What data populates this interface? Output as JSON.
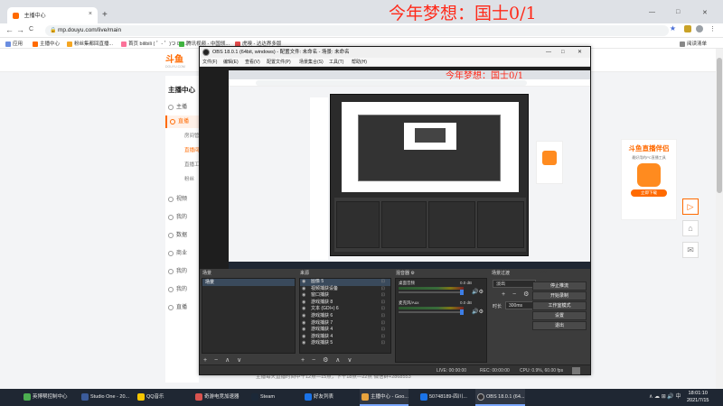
{
  "browser": {
    "tab_title": "主播中心",
    "url": "mp.douyu.com/live/main",
    "win_min": "—",
    "win_max": "□",
    "win_close": "✕",
    "new_tab": "+",
    "tab_close": "×",
    "nav_back": "←",
    "nav_forward": "→",
    "nav_reload": "C",
    "nav_home": "⌂",
    "bookmarks": [
      "应用",
      "主播中心",
      "粉丝集都回直播...",
      "首页 bilibili ( ゜- ゜)つ Da...",
      "腾讯视频 - 中国领...",
      "虎嗅 - 达达界多版"
    ],
    "reading_list": "阅读清单"
  },
  "overlay_headline": "今年梦想：国士0/1",
  "douyu": {
    "logo": "斗鱼",
    "logo_sub": "DOUYU.COM",
    "sidebar_title": "主播中心",
    "sidebar_items": [
      "主播",
      "直播",
      "视频",
      "我的",
      "数据",
      "商业",
      "我的",
      "我的",
      "直播"
    ],
    "sidebar_subs": [
      "房间管",
      "直播间",
      "直播工",
      "粉丝"
    ],
    "footer_line1": "主播每天直播时间中午12点—15点，下午18点—22点 微信群+2868553",
    "promo_title": "斗鱼直播伴侣",
    "promo_sub": "最好用的PC直播工具",
    "promo_btn": "立即下载"
  },
  "obs": {
    "title": "OBS 18.0.1 (64bit, windows) - 配置文件: 未命名 - 场景: 未命名",
    "menu": [
      "文件(F)",
      "编辑(E)",
      "查看(V)",
      "配置文件(P)",
      "场景集合(S)",
      "工具(T)",
      "帮助(H)"
    ],
    "docks": {
      "scenes": "场景",
      "sources": "来源",
      "mixer": "混音器",
      "transitions": "场景过渡",
      "controls": "控件"
    },
    "scenes": [
      "场景"
    ],
    "sources": [
      "图像 5",
      "视频捕获设备",
      "窗口捕获",
      "游戏捕获 8",
      "文本 (GDI+) 6",
      "游戏捕获 6",
      "游戏捕获 7",
      "游戏捕获 4",
      "游戏捕获 4",
      "游戏捕获 5"
    ],
    "mixer": [
      {
        "name": "桌面音频",
        "db": "0.0 dB"
      },
      {
        "name": "麦克风/Aux",
        "db": "0.0 dB"
      }
    ],
    "transition_value": "淡出",
    "duration_label": "时长",
    "duration_value": "300ms",
    "controls": [
      "停止推流",
      "开始录制",
      "工作室模式",
      "设置",
      "退出"
    ],
    "status": {
      "live": "LIVE: 00:00:00",
      "rec": "REC: 00:00:00",
      "cpu": "CPU: 0.9%, 60.00 fps"
    }
  },
  "taskbar": {
    "items": [
      "英博帮控制中心",
      "Studio One - 20...",
      "QQ音乐",
      "奇游电竞加速器",
      "Steam",
      "好友列表",
      "主播中心 - Goo...",
      "50748189-四川...",
      "OBS 18.0.1 (64..."
    ],
    "tray": "∧ ☁ ⊞ 🔊 中",
    "time": "18:01:10",
    "date": "2021/7/15"
  }
}
